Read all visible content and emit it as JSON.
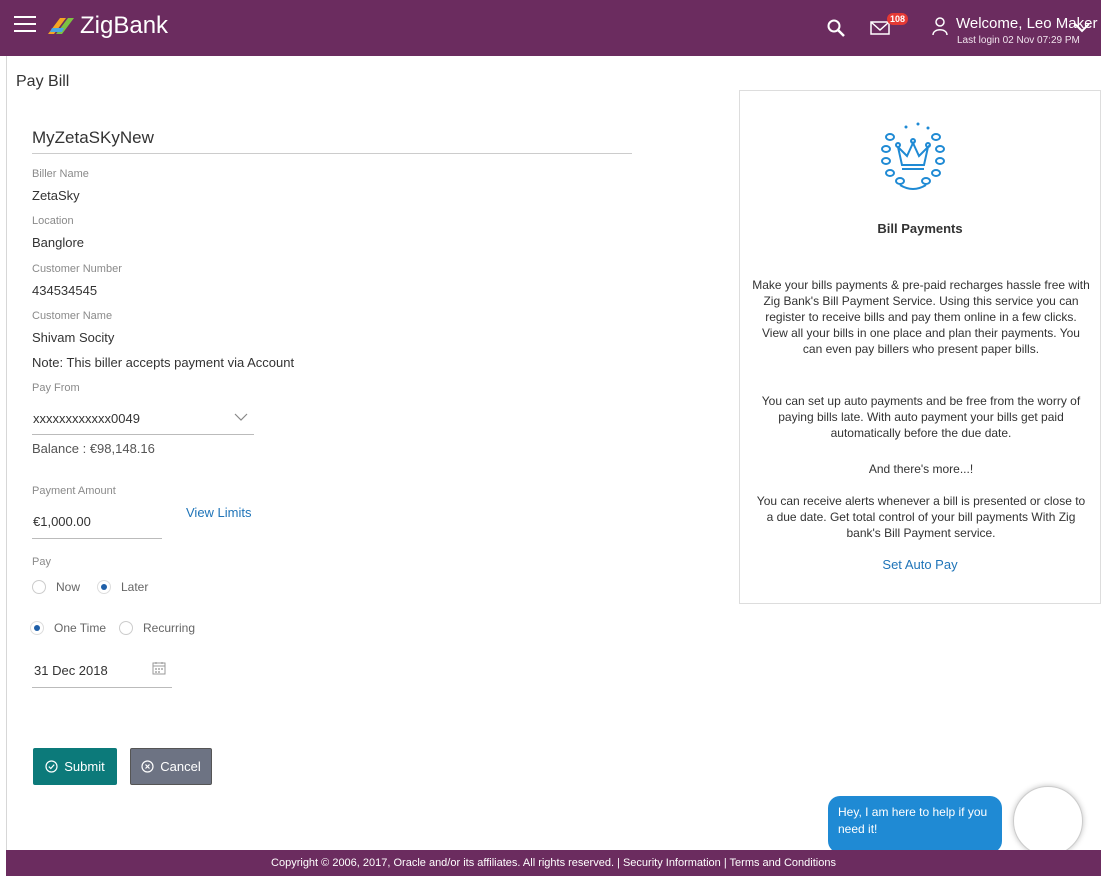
{
  "header": {
    "brand": "ZigBank",
    "notification_count": "108",
    "welcome": "Welcome, Leo Maker",
    "last_login": "Last login 02 Nov 07:29 PM"
  },
  "page": {
    "title": "Pay Bill"
  },
  "form": {
    "payee": "MyZetaSKyNew",
    "biller_name_label": "Biller Name",
    "biller_name": "ZetaSky",
    "location_label": "Location",
    "location": "Banglore",
    "customer_number_label": "Customer Number",
    "customer_number": "434534545",
    "customer_name_label": "Customer Name",
    "customer_name": "Shivam Socity",
    "note": "Note: This biller accepts payment via Account",
    "pay_from_label": "Pay From",
    "pay_from_value": "xxxxxxxxxxxx0049",
    "balance": "Balance : €98,148.16",
    "amount_label": "Payment Amount",
    "amount_value": "€1,000.00",
    "view_limits": "View Limits",
    "pay_label": "Pay",
    "pay_options": [
      "Now",
      "Later"
    ],
    "pay_selected": "Later",
    "frequency_options": [
      "One Time",
      "Recurring"
    ],
    "frequency_selected": "One Time",
    "date_value": "31 Dec 2018"
  },
  "actions": {
    "submit": "Submit",
    "cancel": "Cancel"
  },
  "side_panel": {
    "title": "Bill Payments",
    "para1": "Make your bills payments & pre-paid recharges hassle free with Zig Bank's Bill Payment Service. Using this service you can register to receive bills and pay them online in a few clicks. View all your bills in one place and plan their payments. You can even pay billers who present paper bills.",
    "para2": "You can set up auto payments and be free from the worry of paying bills late. With auto payment your bills get paid automatically before the due date.",
    "para3": "And there's more...!",
    "para4": "You can receive alerts whenever a bill is presented or close to a due date. Get total control of your bill payments With Zig bank's Bill Payment service.",
    "link": "Set Auto Pay"
  },
  "chat": {
    "message": "Hey, I am here to help if you need it!"
  },
  "footer": {
    "text": "Copyright © 2006, 2017, Oracle and/or its affiliates. All rights reserved. | Security Information | Terms and Conditions"
  },
  "colors": {
    "brand": "#6b2c5f",
    "submit": "#0c7a7a",
    "cancel": "#6d7383",
    "link": "#1f74b8",
    "chat": "#1f8ad4"
  },
  "icons": [
    "menu-icon",
    "zigbank-logo",
    "search-icon",
    "mail-icon",
    "user-icon",
    "chevron-down-icon",
    "calendar-icon",
    "check-circle-icon",
    "close-circle-icon",
    "crown-laurel-icon"
  ]
}
